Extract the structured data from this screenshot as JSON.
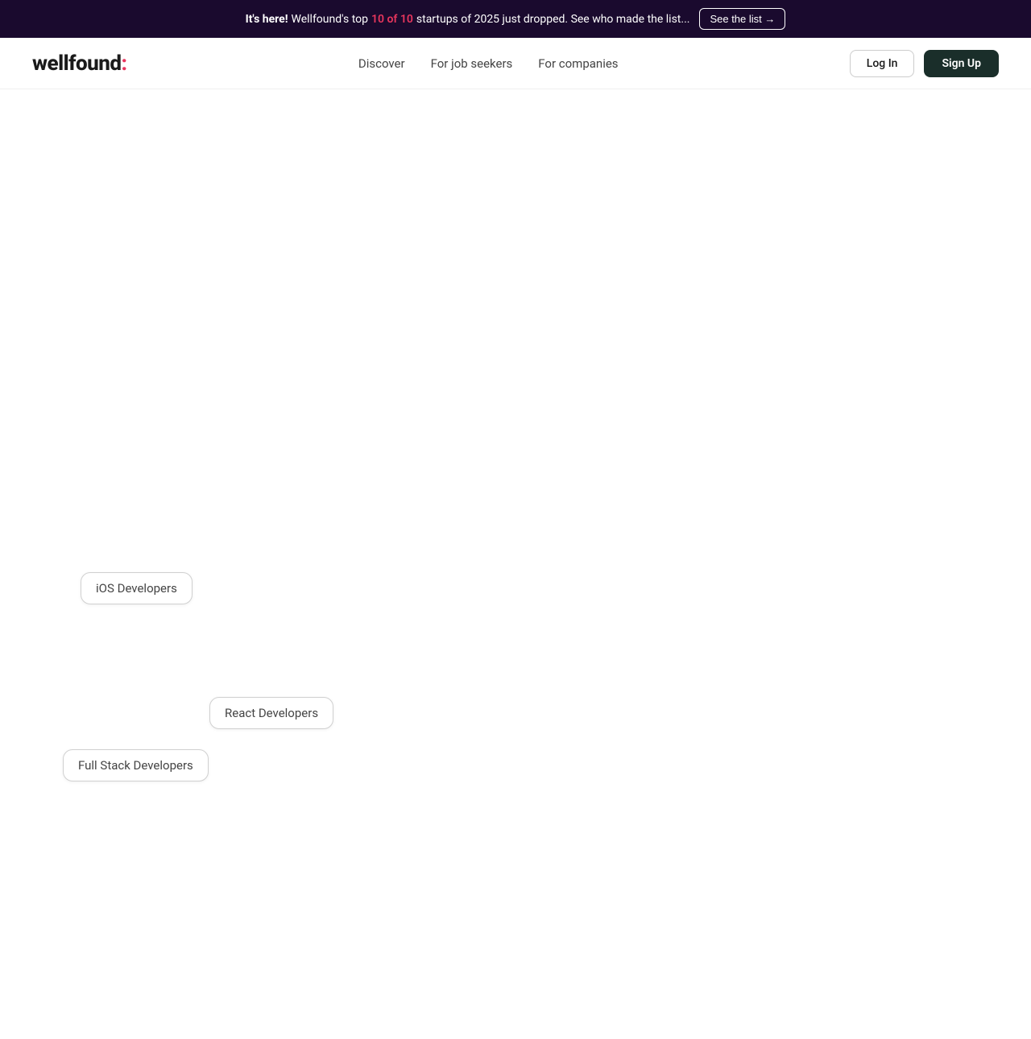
{
  "banner": {
    "bold_text": "It's here!",
    "text": " Wellfound's top ",
    "highlight": "10 of 10",
    "text2": " startups of 2025 just dropped. See who made the list...",
    "button_label": "See the list →"
  },
  "navbar": {
    "logo_text": "wellfound",
    "logo_dot": ":",
    "links": [
      {
        "label": "Discover"
      },
      {
        "label": "For job seekers"
      },
      {
        "label": "For companies"
      }
    ],
    "login_label": "Log In",
    "signup_label": "Sign Up"
  },
  "tags": [
    {
      "label": "iOS Developers",
      "class": "tag-ios"
    },
    {
      "label": "React Developers",
      "class": "tag-react"
    },
    {
      "label": "Full Stack Developers",
      "class": "tag-fullstack"
    }
  ]
}
